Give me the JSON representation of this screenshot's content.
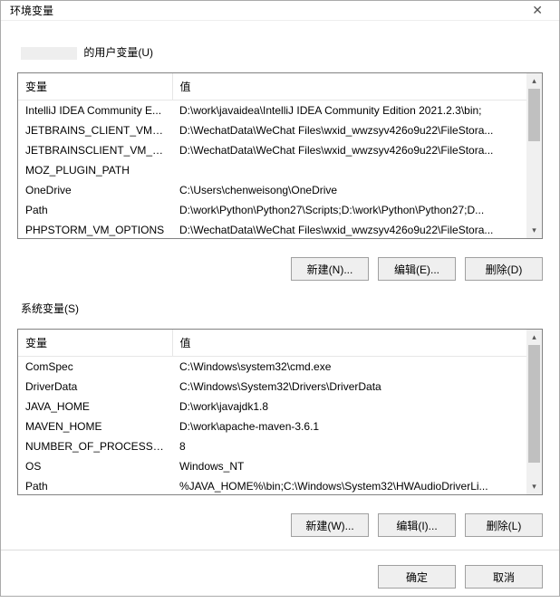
{
  "window": {
    "title": "环境变量"
  },
  "userSection": {
    "label_prefix_redacted": true,
    "label_suffix": " 的用户变量(U)",
    "headers": {
      "name": "变量",
      "value": "值"
    },
    "rows": [
      {
        "name": "IntelliJ IDEA Community E...",
        "value": "D:\\work\\javaidea\\IntelliJ IDEA Community Edition 2021.2.3\\bin;",
        "hl": false
      },
      {
        "name": "JETBRAINS_CLIENT_VM_O...",
        "value": "D:\\WechatData\\WeChat Files\\wxid_wwzsyv426o9u22\\FileStora...",
        "hl": false
      },
      {
        "name": "JETBRAINSCLIENT_VM_O...",
        "value": "D:\\WechatData\\WeChat Files\\wxid_wwzsyv426o9u22\\FileStora...",
        "hl": false
      },
      {
        "name": "MOZ_PLUGIN_PATH",
        "value": "",
        "hl": false
      },
      {
        "name": "OneDrive",
        "value": "C:\\Users\\chenweisong\\OneDrive",
        "hl": false
      },
      {
        "name": "Path",
        "value": "D:\\work\\Python\\Python27\\Scripts;D:\\work\\Python\\Python27;D...",
        "hl": true
      },
      {
        "name": "PHPSTORM_VM_OPTIONS",
        "value": "D:\\WechatData\\WeChat Files\\wxid_wwzsyv426o9u22\\FileStora...",
        "hl": false
      }
    ],
    "buttons": {
      "new": "新建(N)...",
      "edit": "编辑(E)...",
      "delete": "删除(D)"
    }
  },
  "sysSection": {
    "label": "系统变量(S)",
    "headers": {
      "name": "变量",
      "value": "值"
    },
    "rows": [
      {
        "name": "ComSpec",
        "value": "C:\\Windows\\system32\\cmd.exe",
        "hl": false
      },
      {
        "name": "DriverData",
        "value": "C:\\Windows\\System32\\Drivers\\DriverData",
        "hl": false
      },
      {
        "name": "JAVA_HOME",
        "value": "D:\\work\\javajdk1.8",
        "hl": false
      },
      {
        "name": "MAVEN_HOME",
        "value": "D:\\work\\apache-maven-3.6.1",
        "hl": false
      },
      {
        "name": "NUMBER_OF_PROCESSORS",
        "value": "8",
        "hl": false
      },
      {
        "name": "OS",
        "value": "Windows_NT",
        "hl": false
      },
      {
        "name": "Path",
        "value": "%JAVA_HOME%\\bin;C:\\Windows\\System32\\HWAudioDriverLi...",
        "hl": true
      }
    ],
    "buttons": {
      "new": "新建(W)...",
      "edit": "编辑(I)...",
      "delete": "删除(L)"
    }
  },
  "footer": {
    "ok": "确定",
    "cancel": "取消"
  }
}
